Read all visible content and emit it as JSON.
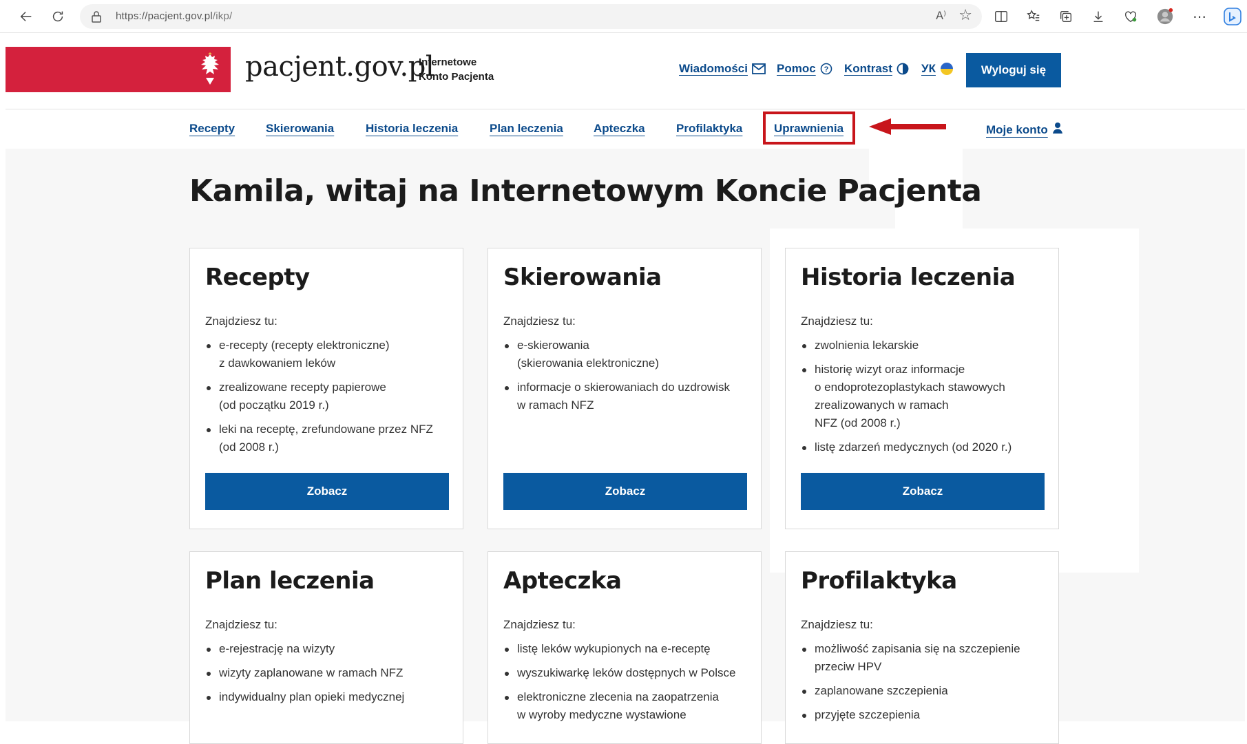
{
  "browser": {
    "url_domain": "https://pacjent.gov.pl",
    "url_path": "/ikp/",
    "read_aloud_label": "A⁾"
  },
  "header": {
    "logo_text": "pacjent.gov.pl",
    "logo_sub": "Internetowe Konto Pacjenta",
    "links": {
      "messages": "Wiadomości",
      "help": "Pomoc",
      "contrast": "Kontrast",
      "language": "УК"
    },
    "logout": "Wyloguj się"
  },
  "nav": {
    "items": [
      "Recepty",
      "Skierowania",
      "Historia leczenia",
      "Plan leczenia",
      "Apteczka",
      "Profilaktyka",
      "Uprawnienia"
    ],
    "account": "Moje konto"
  },
  "main": {
    "title": "Kamila, witaj na Internetowym Koncie Pacjenta",
    "cards": [
      {
        "title": "Recepty",
        "intro": "Znajdziesz tu:",
        "items": [
          "e-recepty (recepty elektroniczne)\nz dawkowaniem leków",
          "zrealizowane recepty papierowe\n(od początku 2019 r.)",
          "leki na receptę, zrefundowane przez NFZ\n(od 2008 r.)"
        ],
        "button": "Zobacz"
      },
      {
        "title": "Skierowania",
        "intro": "Znajdziesz tu:",
        "items": [
          "e-skierowania\n(skierowania elektroniczne)",
          "informacje o skierowaniach do uzdrowisk\nw ramach NFZ"
        ],
        "button": "Zobacz"
      },
      {
        "title": "Historia leczenia",
        "intro": "Znajdziesz tu:",
        "items": [
          "zwolnienia lekarskie",
          "historię wizyt oraz informacje\no endoprotezoplastykach stawowych\nzrealizowanych w ramach\nNFZ (od 2008 r.)",
          "listę zdarzeń medycznych (od 2020 r.)"
        ],
        "button": "Zobacz"
      },
      {
        "title": "Plan leczenia",
        "intro": "Znajdziesz tu:",
        "items": [
          "e-rejestrację na wizyty",
          "wizyty zaplanowane w ramach NFZ",
          "indywidualny plan opieki medycznej"
        ]
      },
      {
        "title": "Apteczka",
        "intro": "Znajdziesz tu:",
        "items": [
          "listę leków wykupionych na e-receptę",
          "wyszukiwarkę leków dostępnych w Polsce",
          "elektroniczne zlecenia na zaopatrzenia\nw wyroby medyczne wystawione"
        ]
      },
      {
        "title": "Profilaktyka",
        "intro": "Znajdziesz tu:",
        "items": [
          "możliwość zapisania się na szczepienie\nprzeciw HPV",
          "zaplanowane szczepienia",
          "przyjęte szczepienia"
        ]
      }
    ]
  },
  "colors": {
    "brand_red": "#d4213d",
    "link_blue": "#0b4a8b",
    "button_blue": "#0a5aa0",
    "annotation_red": "#c8151b"
  }
}
